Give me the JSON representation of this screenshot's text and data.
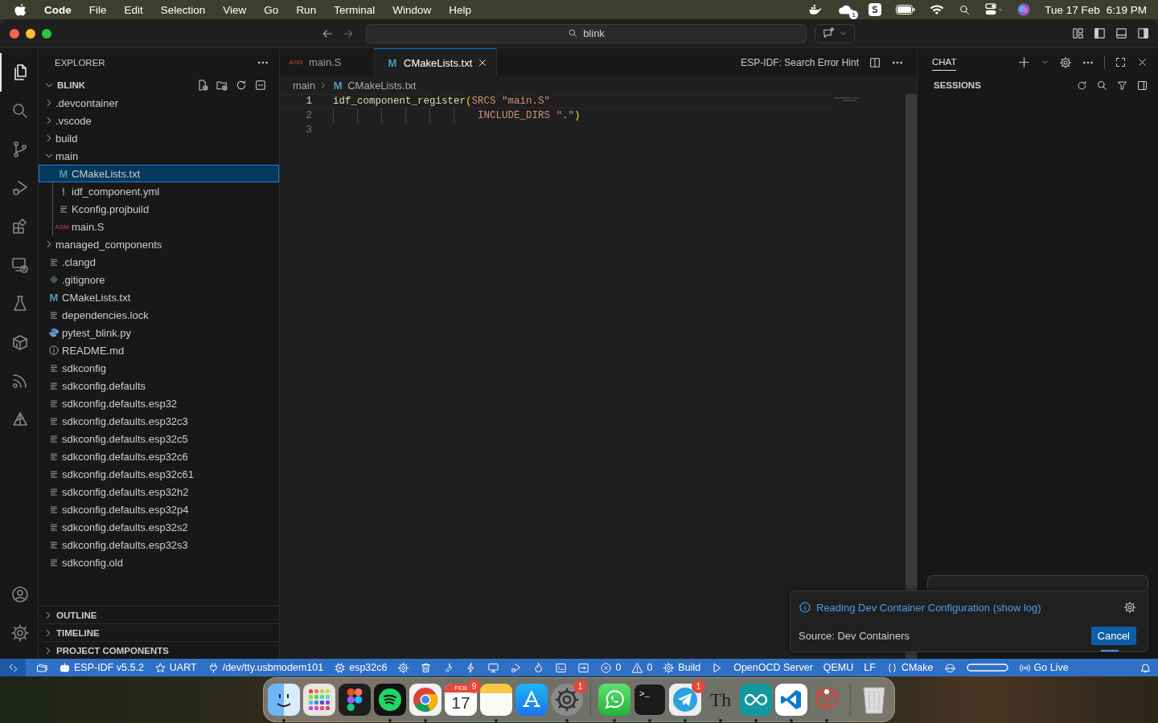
{
  "menubar": {
    "app": "Code",
    "menus": [
      "File",
      "Edit",
      "Selection",
      "View",
      "Go",
      "Run",
      "Terminal",
      "Window",
      "Help"
    ],
    "cloud_badge": "1",
    "date": "Tue 17 Feb",
    "time": "6:19 PM"
  },
  "titlebar": {
    "search": "blink"
  },
  "activity_bar": {
    "items": [
      {
        "kind": "files",
        "selected": true
      },
      {
        "kind": "search",
        "selected": false
      },
      {
        "kind": "branch",
        "selected": false
      },
      {
        "kind": "debug",
        "selected": false
      },
      {
        "kind": "extensions",
        "selected": false
      },
      {
        "kind": "remote",
        "selected": false
      },
      {
        "kind": "flask",
        "selected": false
      },
      {
        "kind": "package",
        "selected": false
      },
      {
        "kind": "signal",
        "selected": false
      },
      {
        "kind": "sail",
        "selected": false
      }
    ],
    "bottom": [
      {
        "kind": "account"
      },
      {
        "kind": "gear"
      }
    ]
  },
  "explorer": {
    "title": "EXPLORER",
    "root": {
      "label": "BLINK",
      "expanded": true
    },
    "tree": [
      {
        "kind": "folder",
        "label": ".devcontainer",
        "expanded": false,
        "selected": false
      },
      {
        "kind": "folder",
        "label": ".vscode",
        "expanded": false,
        "selected": false
      },
      {
        "kind": "folder",
        "label": "build",
        "expanded": false,
        "selected": false
      },
      {
        "kind": "folder",
        "label": "main",
        "expanded": true,
        "selected": false,
        "children": [
          {
            "kind": "cmake",
            "icon_text": "M",
            "label": "CMakeLists.txt",
            "selected": true
          },
          {
            "kind": "yaml",
            "icon_text": "!",
            "label": "idf_component.yml",
            "selected": false
          },
          {
            "kind": "text",
            "label": "Kconfig.projbuild",
            "selected": false
          },
          {
            "kind": "asm",
            "icon_text": "ASM",
            "label": "main.S",
            "selected": false
          }
        ]
      },
      {
        "kind": "folder",
        "label": "managed_components",
        "expanded": false,
        "selected": false
      },
      {
        "kind": "text",
        "label": ".clangd",
        "selected": false
      },
      {
        "kind": "git",
        "label": ".gitignore",
        "selected": false
      },
      {
        "kind": "cmake",
        "icon_text": "M",
        "label": "CMakeLists.txt",
        "selected": false
      },
      {
        "kind": "text",
        "label": "dependencies.lock",
        "selected": false
      },
      {
        "kind": "python",
        "label": "pytest_blink.py",
        "selected": false
      },
      {
        "kind": "info",
        "label": "README.md",
        "selected": false
      },
      {
        "kind": "text",
        "label": "sdkconfig",
        "selected": false
      },
      {
        "kind": "text",
        "label": "sdkconfig.defaults",
        "selected": false
      },
      {
        "kind": "text",
        "label": "sdkconfig.defaults.esp32",
        "selected": false
      },
      {
        "kind": "text",
        "label": "sdkconfig.defaults.esp32c3",
        "selected": false
      },
      {
        "kind": "text",
        "label": "sdkconfig.defaults.esp32c5",
        "selected": false
      },
      {
        "kind": "text",
        "label": "sdkconfig.defaults.esp32c6",
        "selected": false
      },
      {
        "kind": "text",
        "label": "sdkconfig.defaults.esp32c61",
        "selected": false
      },
      {
        "kind": "text",
        "label": "sdkconfig.defaults.esp32h2",
        "selected": false
      },
      {
        "kind": "text",
        "label": "sdkconfig.defaults.esp32p4",
        "selected": false
      },
      {
        "kind": "text",
        "label": "sdkconfig.defaults.esp32s2",
        "selected": false
      },
      {
        "kind": "text",
        "label": "sdkconfig.defaults.esp32s3",
        "selected": false
      },
      {
        "kind": "text",
        "label": "sdkconfig.old",
        "selected": false
      }
    ],
    "sections": [
      {
        "label": "OUTLINE",
        "expanded": false
      },
      {
        "label": "TIMELINE",
        "expanded": false
      },
      {
        "label": "PROJECT COMPONENTS",
        "expanded": false
      }
    ]
  },
  "editor": {
    "tabs": [
      {
        "kind": "asm",
        "icon_text": "ASM",
        "label": "main.S",
        "selected": false
      },
      {
        "kind": "cmake",
        "icon_text": "M",
        "label": "CMakeLists.txt",
        "selected": true
      }
    ],
    "action": "ESP-IDF: Search Error Hint",
    "breadcrumb": [
      {
        "label": "main"
      },
      {
        "kind": "cmake",
        "icon_text": "M",
        "label": "CMakeLists.txt"
      }
    ],
    "lines": [
      {
        "number": "1",
        "tokens": [
          {
            "kind": "function",
            "text": "idf_component_register"
          },
          {
            "kind": "bracket",
            "text": "("
          },
          {
            "kind": "argument",
            "text": "SRCS "
          },
          {
            "kind": "string",
            "text": "\"main.S\""
          }
        ]
      },
      {
        "number": "2",
        "tokens": [
          {
            "kind": "indent"
          },
          {
            "kind": "argument",
            "text": "INCLUDE_DIRS "
          },
          {
            "kind": "string",
            "text": "\".\""
          },
          {
            "kind": "bracket",
            "text": ")"
          }
        ]
      },
      {
        "number": "3"
      }
    ]
  },
  "chat": {
    "tabs": [
      {
        "label": "CHAT",
        "selected": true
      }
    ],
    "sessions_title": "SESSIONS"
  },
  "notification": {
    "message": "Reading Dev Container Configuration (show log)",
    "source": "Source: Dev Containers",
    "button": "Cancel"
  },
  "status_bar": {
    "items": [
      {
        "kind": "remote"
      },
      {
        "kind": "folders"
      },
      {
        "kind": "robot",
        "label": "ESP-IDF v5.5.2"
      },
      {
        "kind": "star",
        "label": "UART"
      },
      {
        "kind": "plug",
        "label": "/dev/tty.usbmodem101"
      },
      {
        "kind": "chip",
        "label": "esp32c6"
      },
      {
        "kind": "gear"
      },
      {
        "kind": "trash"
      },
      {
        "kind": "wrench"
      },
      {
        "kind": "bolt"
      },
      {
        "kind": "monitor"
      },
      {
        "kind": "debug"
      },
      {
        "kind": "flame"
      },
      {
        "kind": "terminal"
      },
      {
        "kind": "enter"
      },
      {
        "kind": "error",
        "label": "0"
      },
      {
        "kind": "warning",
        "label": "0"
      },
      {
        "kind": "gear",
        "label": "Build"
      },
      {
        "kind": "play"
      },
      {
        "label": "OpenOCD Server"
      },
      {
        "label": "QEMU"
      },
      {
        "label": "LF"
      },
      {
        "kind": "braces",
        "label": "CMake"
      },
      {
        "kind": "copilot"
      },
      {
        "kind": "pill"
      },
      {
        "kind": "broadcast",
        "label": "Go Live"
      },
      {
        "kind": "bell"
      }
    ]
  },
  "dock": {
    "apps": [
      {
        "kind": "finder",
        "running": true
      },
      {
        "kind": "launchpad",
        "running": false
      },
      {
        "kind": "figma",
        "running": false
      },
      {
        "kind": "spotify",
        "running": true
      },
      {
        "kind": "chrome",
        "running": true
      },
      {
        "kind": "calendar",
        "month": "FEB",
        "day": "17",
        "badge": "9",
        "running": false
      },
      {
        "kind": "notes",
        "running": true
      },
      {
        "kind": "appstore",
        "running": false
      },
      {
        "kind": "settings",
        "badge": "1",
        "running": true
      },
      {
        "kind": "separator"
      },
      {
        "kind": "whatsapp",
        "running": true
      },
      {
        "kind": "terminal",
        "icon_text": ">_",
        "running": true
      },
      {
        "kind": "telegram",
        "badge": "1",
        "running": true
      },
      {
        "kind": "text",
        "icon_text": "Th",
        "running": true
      },
      {
        "kind": "arduino",
        "running": true
      },
      {
        "kind": "vscode",
        "running": true
      },
      {
        "kind": "cubes",
        "running": true
      },
      {
        "kind": "separator"
      },
      {
        "kind": "trash",
        "running": false
      }
    ]
  }
}
